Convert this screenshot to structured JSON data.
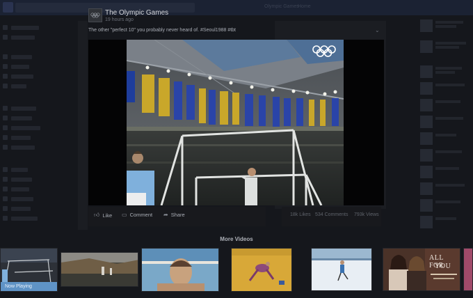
{
  "background": {
    "top_links": [
      "Olympic Games",
      "Home"
    ]
  },
  "post": {
    "page_name": "The Olympic Games",
    "timestamp": "19 hours ago",
    "caption": "The other \"perfect 10\" you probably never heard of. #Seoul1988 #tbt"
  },
  "actions": {
    "like": "Like",
    "comment": "Comment",
    "share": "Share"
  },
  "stats": {
    "likes": "18k Likes",
    "comments": "534 Comments",
    "views": "793k Views"
  },
  "more_videos": {
    "title": "More Videos",
    "now_playing": "Now Playing",
    "thumb_overlay_text": [
      "ALL FOR",
      "YOU"
    ]
  },
  "colors": {
    "now_playing_bar": "#5f93c6",
    "background": "#15171c"
  }
}
